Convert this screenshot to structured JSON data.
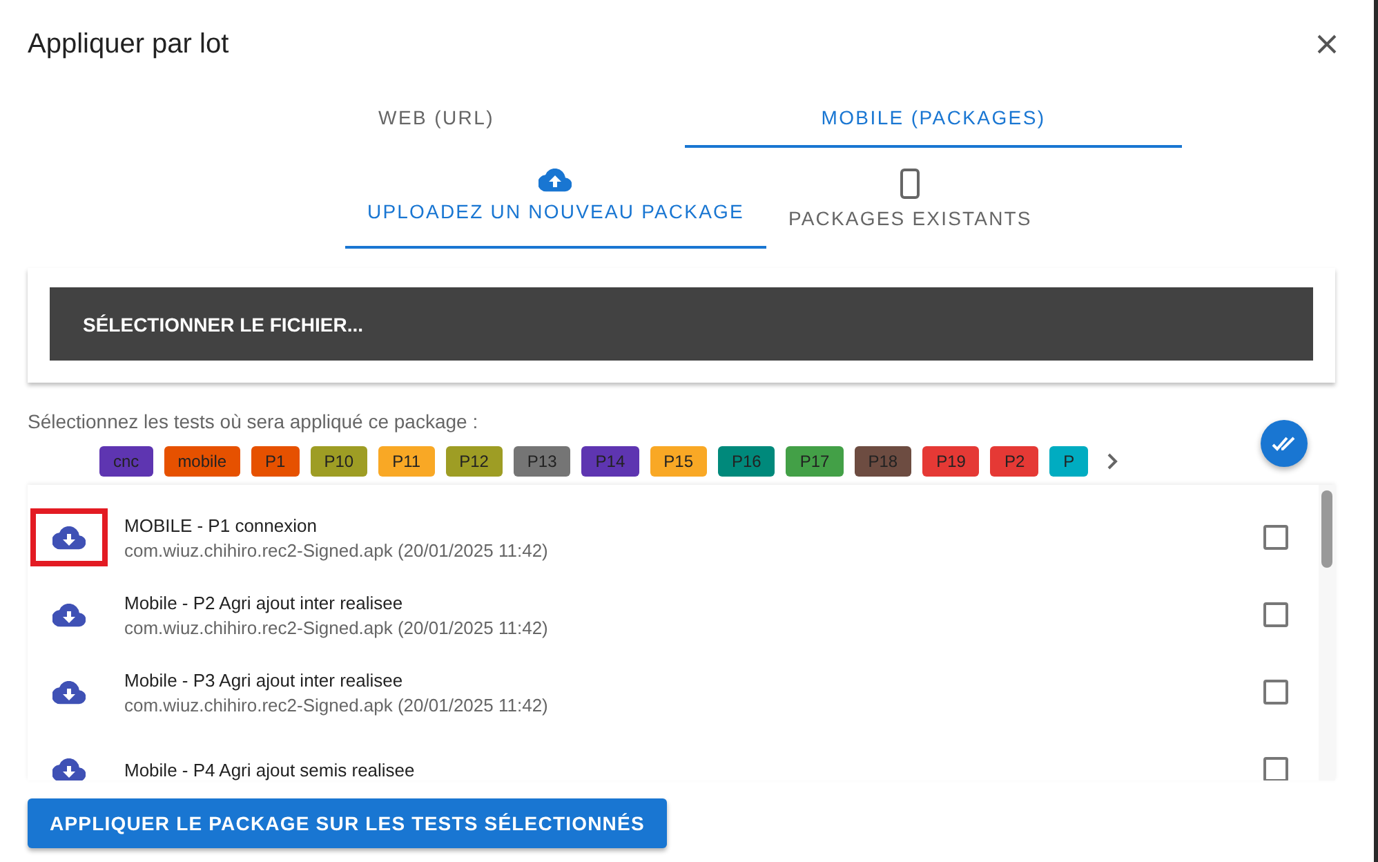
{
  "dialog": {
    "title": "Appliquer par lot"
  },
  "tabs": [
    {
      "label": "WEB (URL)",
      "selected": false
    },
    {
      "label": "MOBILE (PACKAGES)",
      "selected": true
    }
  ],
  "subtabs": [
    {
      "label": "UPLOADEZ UN NOUVEAU PACKAGE",
      "kind": "upload",
      "selected": true
    },
    {
      "label": "PACKAGES EXISTANTS",
      "kind": "phone",
      "selected": false
    }
  ],
  "file_button": "SÉLECTIONNER LE FICHIER...",
  "tests_label": "Sélectionnez les tests où sera appliqué ce package :",
  "tags": [
    {
      "label": "cnc",
      "color": "#5e35b1"
    },
    {
      "label": "mobile",
      "color": "#e65100"
    },
    {
      "label": "P1",
      "color": "#e65100"
    },
    {
      "label": "P10",
      "color": "#9e9d24"
    },
    {
      "label": "P11",
      "color": "#f9a825"
    },
    {
      "label": "P12",
      "color": "#9e9d24"
    },
    {
      "label": "P13",
      "color": "#757575"
    },
    {
      "label": "P14",
      "color": "#5e35b1"
    },
    {
      "label": "P15",
      "color": "#f9a825"
    },
    {
      "label": "P16",
      "color": "#00897b"
    },
    {
      "label": "P17",
      "color": "#43a047"
    },
    {
      "label": "P18",
      "color": "#6d4c41"
    },
    {
      "label": "P19",
      "color": "#e53935"
    },
    {
      "label": "P2",
      "color": "#e53935"
    },
    {
      "label": "P",
      "color": "#00acc1"
    }
  ],
  "packages": [
    {
      "title": "MOBILE - P1 connexion",
      "file": "com.wiuz.chihiro.rec2-Signed.apk (20/01/2025 11:42)",
      "checked": false,
      "highlighted": true
    },
    {
      "title": "Mobile - P2 Agri ajout inter realisee",
      "file": "com.wiuz.chihiro.rec2-Signed.apk (20/01/2025 11:42)",
      "checked": false,
      "highlighted": false
    },
    {
      "title": "Mobile - P3 Agri ajout inter realisee",
      "file": "com.wiuz.chihiro.rec2-Signed.apk (20/01/2025 11:42)",
      "checked": false,
      "highlighted": false
    },
    {
      "title": "Mobile - P4 Agri ajout semis realisee",
      "checked": false,
      "highlighted": false
    }
  ],
  "apply_button": "APPLIQUER LE PACKAGE SUR LES TESTS SÉLECTIONNÉS"
}
